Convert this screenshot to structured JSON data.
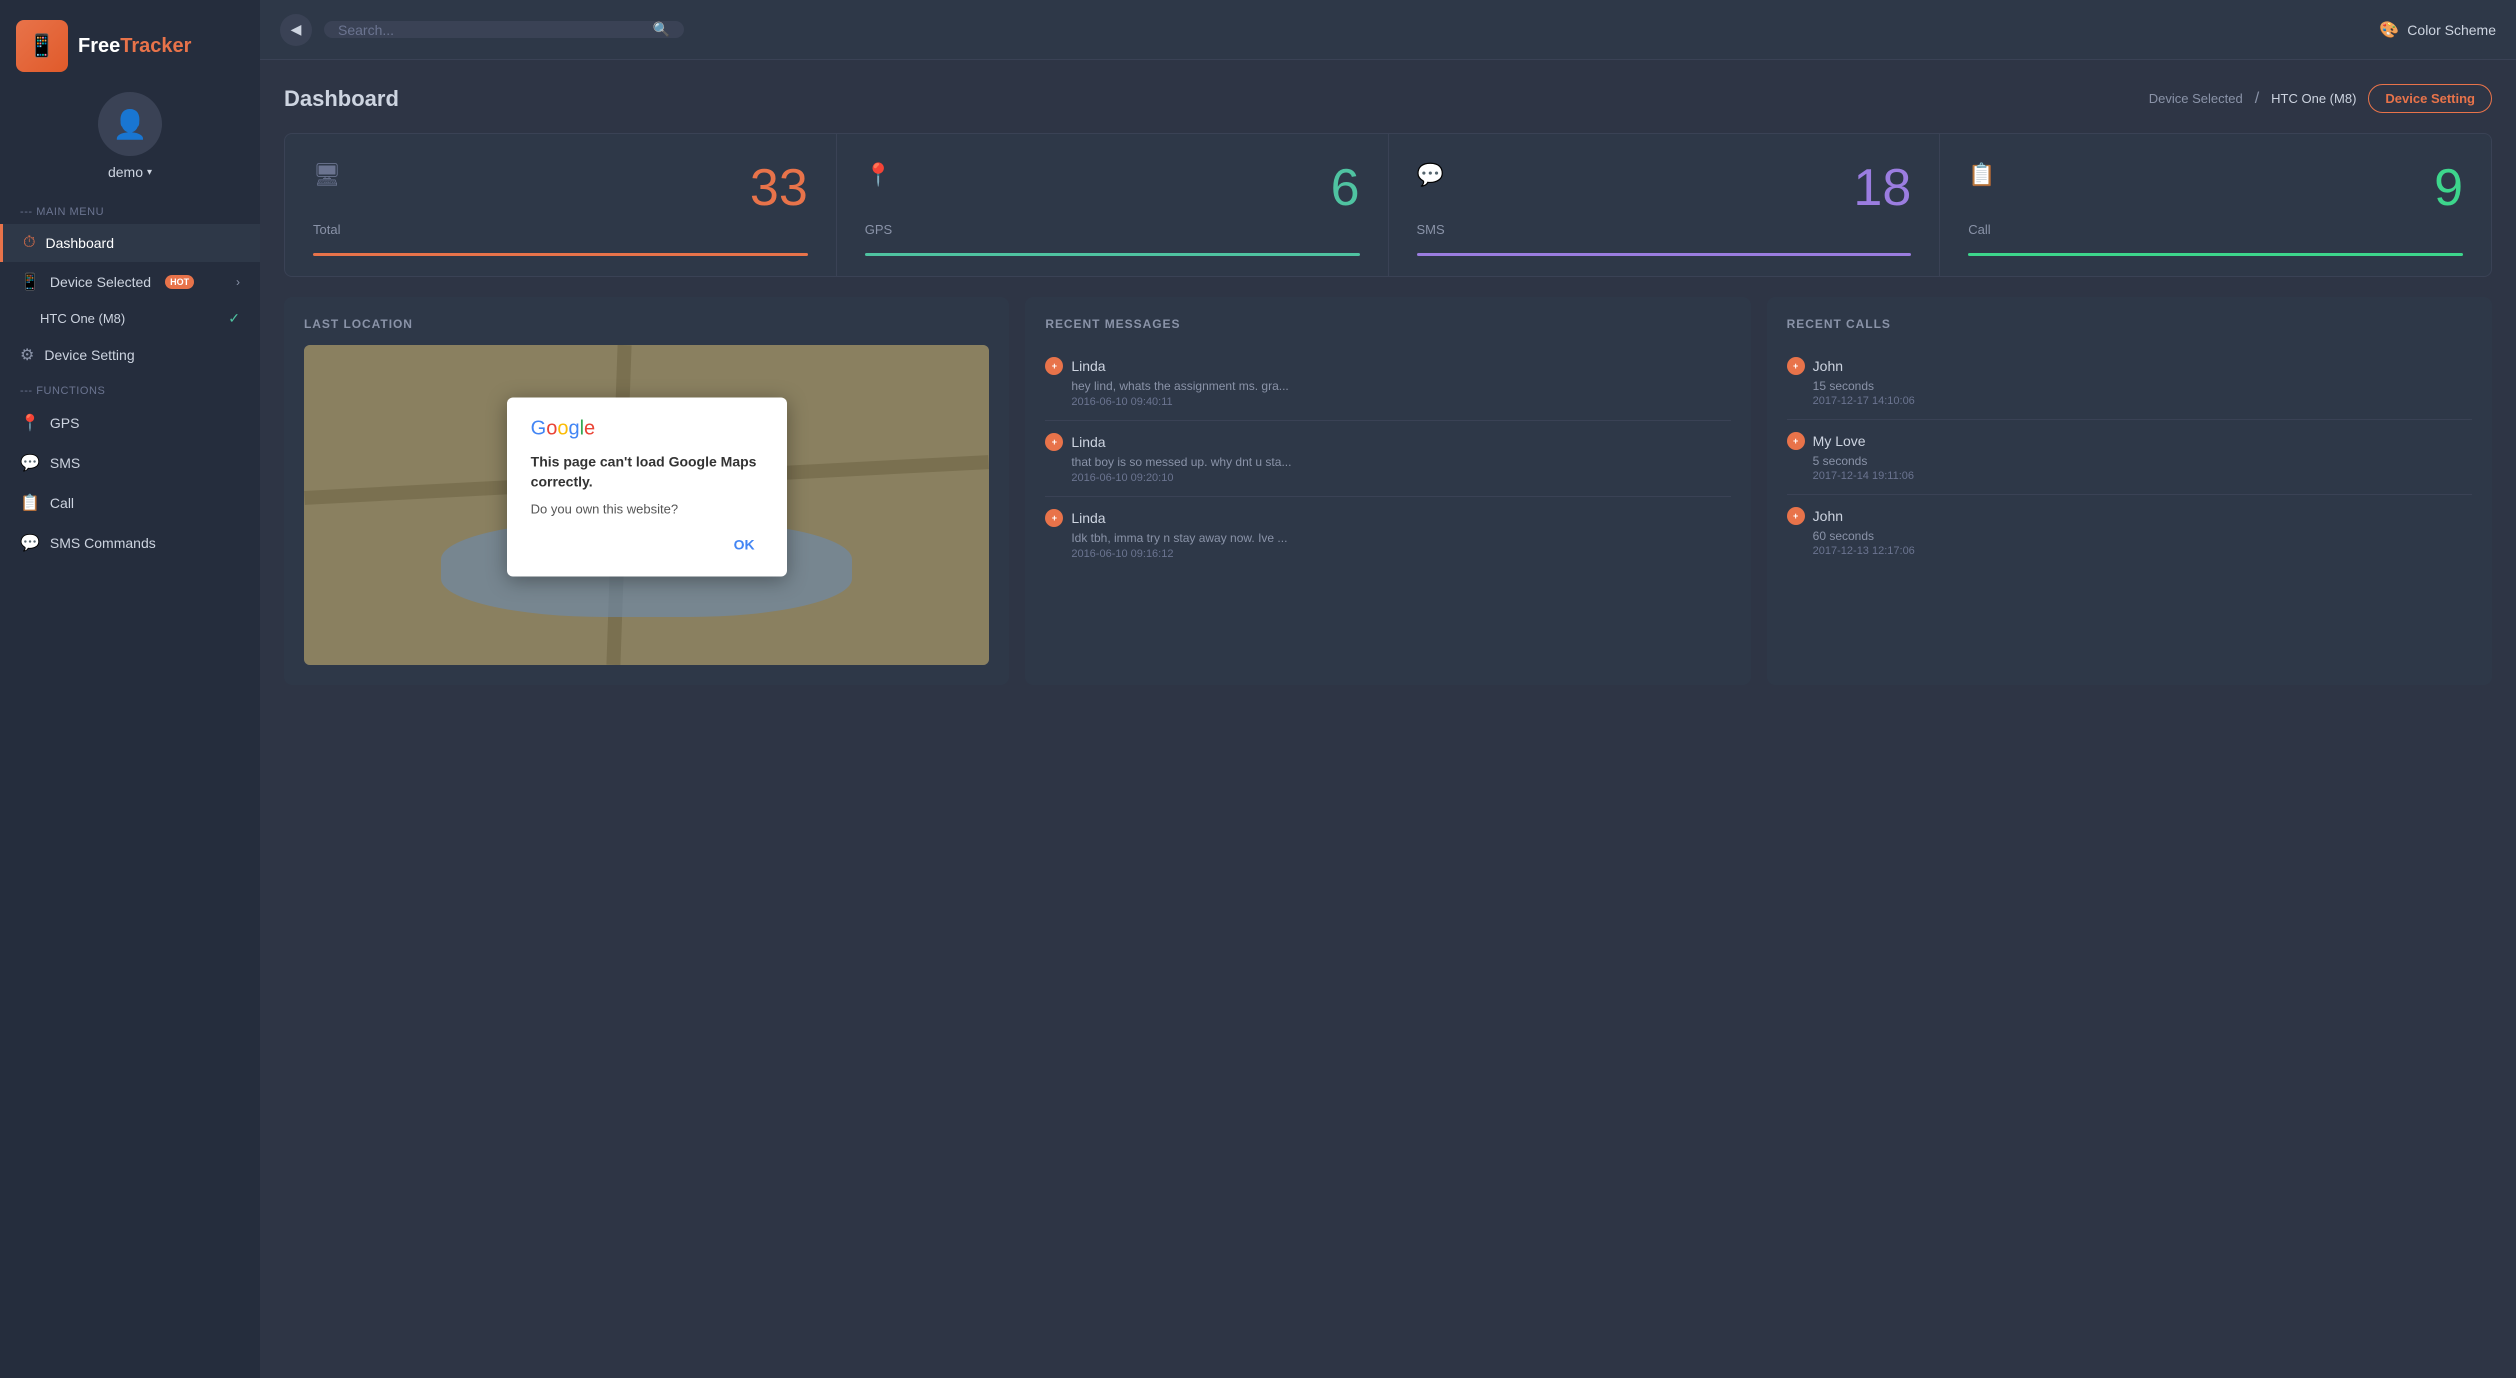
{
  "app": {
    "name": "FreeTracker",
    "name_free": "Free",
    "name_tracker": "Tracker"
  },
  "topbar": {
    "search_placeholder": "Search...",
    "color_scheme_label": "Color Scheme"
  },
  "user": {
    "name": "demo"
  },
  "sidebar": {
    "main_menu_label": "--- MAIN MENU",
    "functions_label": "--- FUNCTIONS",
    "items": [
      {
        "id": "dashboard",
        "label": "Dashboard",
        "icon": "⏱"
      },
      {
        "id": "device-selected",
        "label": "Device Selected",
        "badge": "HOT",
        "icon": "📱"
      },
      {
        "id": "device-setting",
        "label": "Device Setting",
        "icon": "⚙"
      }
    ],
    "sub_device": "HTC One (M8)",
    "functions": [
      {
        "id": "gps",
        "label": "GPS",
        "icon": "📍"
      },
      {
        "id": "sms",
        "label": "SMS",
        "icon": "💬"
      },
      {
        "id": "call",
        "label": "Call",
        "icon": "📋"
      },
      {
        "id": "sms-commands",
        "label": "SMS Commands",
        "icon": "💬"
      }
    ]
  },
  "dashboard": {
    "title": "Dashboard",
    "device_selected_label": "Device Selected",
    "separator": "/",
    "device_name": "HTC One (M8)",
    "device_setting_btn": "Device Setting"
  },
  "stats": [
    {
      "id": "total",
      "label": "Total",
      "value": "33",
      "color": "orange",
      "icon": "🖥"
    },
    {
      "id": "gps",
      "label": "GPS",
      "value": "6",
      "color": "teal",
      "icon": "📍"
    },
    {
      "id": "sms",
      "label": "SMS",
      "value": "18",
      "color": "purple",
      "icon": "💬"
    },
    {
      "id": "call",
      "label": "Call",
      "value": "9",
      "color": "green",
      "icon": "📋"
    }
  ],
  "last_location": {
    "title": "LAST LOCATION",
    "dialog": {
      "logo": "Google",
      "message": "This page can't load Google Maps correctly.",
      "question": "Do you own this website?",
      "ok_btn": "OK"
    }
  },
  "recent_messages": {
    "title": "RECENT MESSAGES",
    "items": [
      {
        "sender": "Linda",
        "preview": "hey lind, whats the assignment ms. gra...",
        "time": "2016-06-10 09:40:11"
      },
      {
        "sender": "Linda",
        "preview": "that boy is so messed up. why dnt u sta...",
        "time": "2016-06-10 09:20:10"
      },
      {
        "sender": "Linda",
        "preview": "Idk tbh, imma try n stay away now. Ive ...",
        "time": "2016-06-10 09:16:12"
      }
    ]
  },
  "recent_calls": {
    "title": "RECENT CALLS",
    "items": [
      {
        "name": "John",
        "duration": "15 seconds",
        "time": "2017-12-17 14:10:06"
      },
      {
        "name": "My Love",
        "duration": "5 seconds",
        "time": "2017-12-14 19:11:06"
      },
      {
        "name": "John",
        "duration": "60 seconds",
        "time": "2017-12-13 12:17:06"
      }
    ]
  }
}
